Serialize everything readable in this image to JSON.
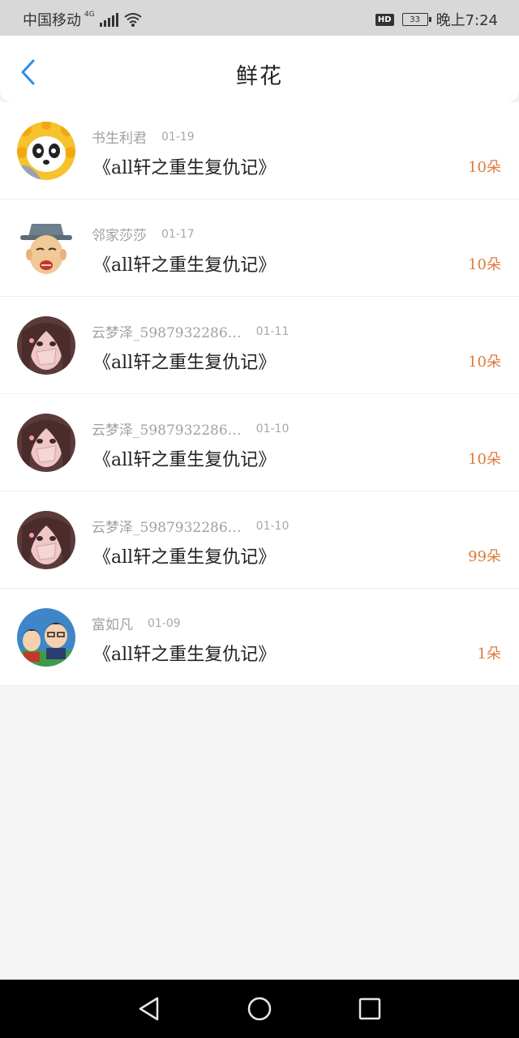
{
  "status_bar": {
    "carrier": "中国移动",
    "network": "4G",
    "hd": "HD",
    "battery": "33",
    "time": "晚上7:24"
  },
  "header": {
    "title": "鲜花",
    "back_icon": "chevron-left-icon"
  },
  "colors": {
    "accent": "#2b8fe5",
    "amount": "#e0783a"
  },
  "items": [
    {
      "user": "书生利君",
      "date": "01-19",
      "book": "《all轩之重生复仇记》",
      "amount": "10朵",
      "avatar": "panda-sunflower"
    },
    {
      "user": "邻家莎莎",
      "date": "01-17",
      "book": "《all轩之重生复仇记》",
      "amount": "10朵",
      "avatar": "old-man-hat"
    },
    {
      "user": "云梦泽_5987932286…",
      "date": "01-11",
      "book": "《all轩之重生复仇记》",
      "amount": "10朵",
      "avatar": "girl-portrait"
    },
    {
      "user": "云梦泽_5987932286…",
      "date": "01-10",
      "book": "《all轩之重生复仇记》",
      "amount": "10朵",
      "avatar": "girl-portrait"
    },
    {
      "user": "云梦泽_5987932286…",
      "date": "01-10",
      "book": "《all轩之重生复仇记》",
      "amount": "99朵",
      "avatar": "girl-portrait"
    },
    {
      "user": "富如凡",
      "date": "01-09",
      "book": "《all轩之重生复仇记》",
      "amount": "1朵",
      "avatar": "anime-group"
    }
  ],
  "nav": {
    "back": "back-triangle-icon",
    "home": "home-circle-icon",
    "recents": "recents-square-icon"
  }
}
